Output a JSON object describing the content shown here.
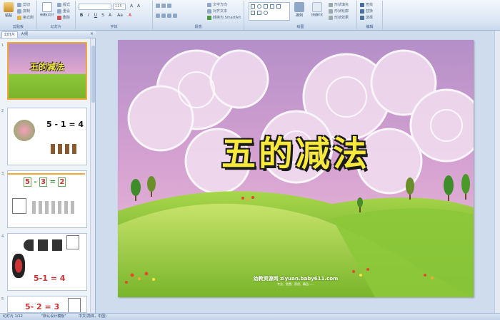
{
  "ribbon": {
    "groups": [
      {
        "label": "剪贴板",
        "items": [
          "粘贴",
          "剪切",
          "复制",
          "格式刷"
        ]
      },
      {
        "label": "幻灯片",
        "items": [
          "新建幻灯片",
          "版式",
          "重设",
          "删除"
        ]
      },
      {
        "label": "字体",
        "font_size": "115"
      },
      {
        "label": "段落",
        "items": [
          "文字方向",
          "对齐文本",
          "转换为 SmartArt"
        ]
      },
      {
        "label": "绘图",
        "items": [
          "排列",
          "快速样式",
          "形状填充",
          "形状轮廓",
          "形状效果"
        ]
      },
      {
        "label": "编辑",
        "items": [
          "查找",
          "替换",
          "选择"
        ]
      }
    ],
    "format_buttons": [
      "B",
      "I",
      "U",
      "S",
      "A",
      "Aa",
      "A"
    ]
  },
  "left_panel": {
    "tabs": [
      "幻灯片",
      "大纲"
    ],
    "close": "×",
    "slides": [
      {
        "number": "1",
        "title": "五的减法"
      },
      {
        "number": "2",
        "equation": "5 - 1 = 4"
      },
      {
        "number": "3",
        "eq": [
          "5",
          "-",
          "3",
          "=",
          "2"
        ]
      },
      {
        "number": "4",
        "equation": "5-1 = 4"
      },
      {
        "number": "5",
        "equation": "5- 2 = 3"
      }
    ]
  },
  "slide": {
    "title": "五的减法",
    "watermark": "幼教资源网 ziyuan.baby611.com",
    "watermark_sub": "专业、免费、原创、精品……"
  },
  "status": {
    "slide_counter": "幻灯片 1/12",
    "theme": "\"默认设计模板\"",
    "language": "中文(简体，中国)"
  },
  "colors": {
    "selection": "#f2a93b",
    "title_fill": "#f7e93b",
    "sky_top": "#b48fc8",
    "grass": "#8cc83a"
  }
}
